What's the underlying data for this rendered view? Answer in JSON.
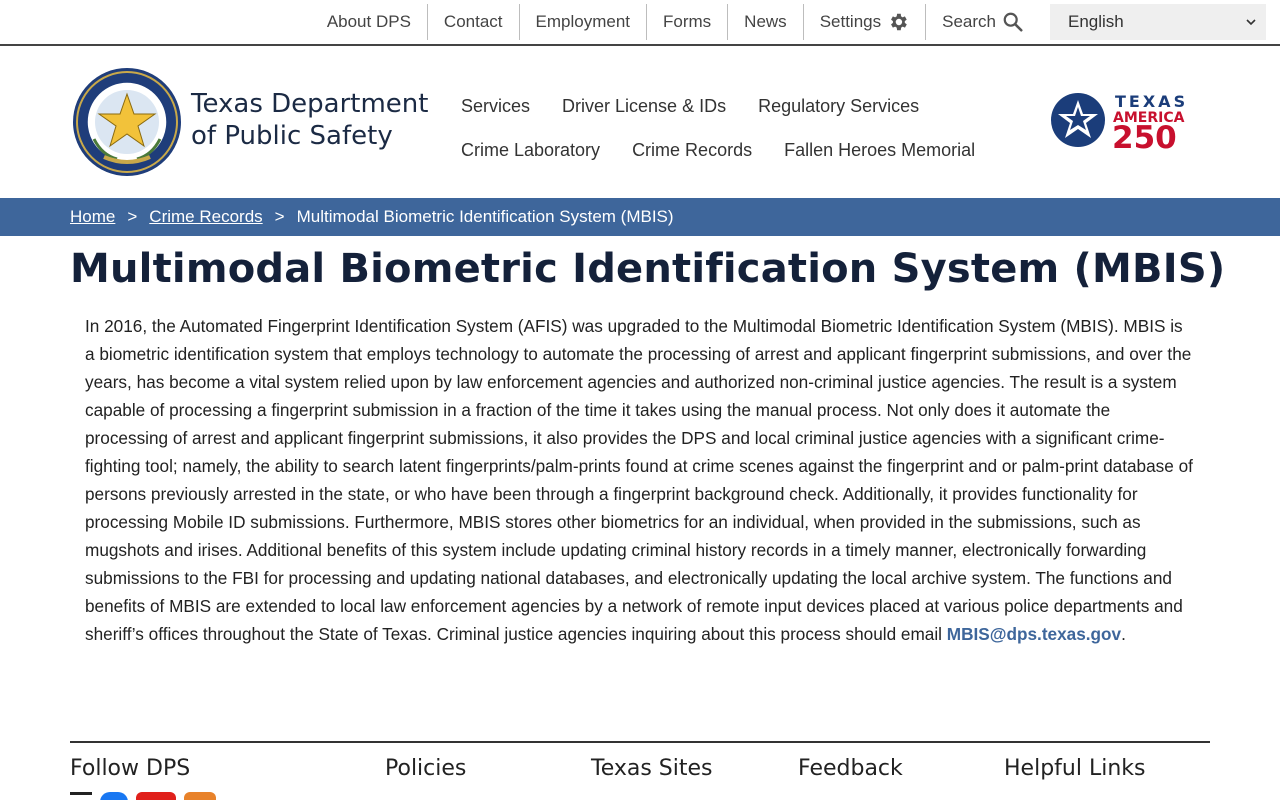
{
  "utility": {
    "links": [
      "About DPS",
      "Contact",
      "Employment",
      "Forms",
      "News",
      "Settings",
      "Search"
    ],
    "language": "English"
  },
  "header": {
    "agency_line1": "Texas Department",
    "agency_line2": "of Public Safety",
    "nav_row1": [
      "Services",
      "Driver License & IDs",
      "Regulatory Services"
    ],
    "nav_row2": [
      "Crime Laboratory",
      "Crime Records",
      "Fallen Heroes Memorial"
    ],
    "badge_top": "TEXAS",
    "badge_mid": "AMERICA",
    "badge_num": "250"
  },
  "breadcrumb": {
    "home": "Home",
    "sep": ">",
    "section": "Crime Records",
    "current": "Multimodal Biometric Identification System (MBIS)"
  },
  "page": {
    "title": "Multimodal Biometric Identification System (MBIS)",
    "body": "In 2016, the Automated Fingerprint Identification System (AFIS) was upgraded to the Multimodal Biometric Identification System (MBIS). MBIS is a biometric identification system that employs technology to automate the processing of arrest and applicant fingerprint submissions, and over the years, has become a vital system relied upon by law enforcement agencies and authorized non-criminal justice agencies. The result is a system capable of processing a fingerprint submission in a fraction of the time it takes using the manual process. Not only does it automate the processing of arrest and applicant fingerprint submissions, it also provides the DPS and local criminal justice agencies with a significant crime-fighting tool; namely, the ability to search latent fingerprints/palm-prints found at crime scenes against the fingerprint and or palm-print database of persons previously arrested in the state, or who have been through a fingerprint background check.  Additionally, it provides functionality for processing Mobile ID submissions.  Furthermore, MBIS stores other biometrics for an individual, when provided in the submissions, such as mugshots and irises.  Additional benefits of this system include updating criminal history records in a timely manner, electronically forwarding submissions to the FBI for processing and updating national databases, and electronically updating the local archive system.  The functions and benefits of MBIS are extended to local law enforcement agencies by a network of remote input devices placed at various police departments and sheriff’s offices throughout the State of Texas. Criminal justice agencies inquiring about this process should email ",
    "email": "MBIS@dps.texas.gov",
    "end": "."
  },
  "footer": {
    "headings": [
      "Follow DPS",
      "Policies",
      "Texas Sites",
      "Feedback",
      "Helpful Links"
    ]
  },
  "colors": {
    "breadcrumb_bg": "#3e669b",
    "title": "#14213a",
    "badge_blue": "#1b3d7a",
    "badge_red": "#c8102e"
  }
}
